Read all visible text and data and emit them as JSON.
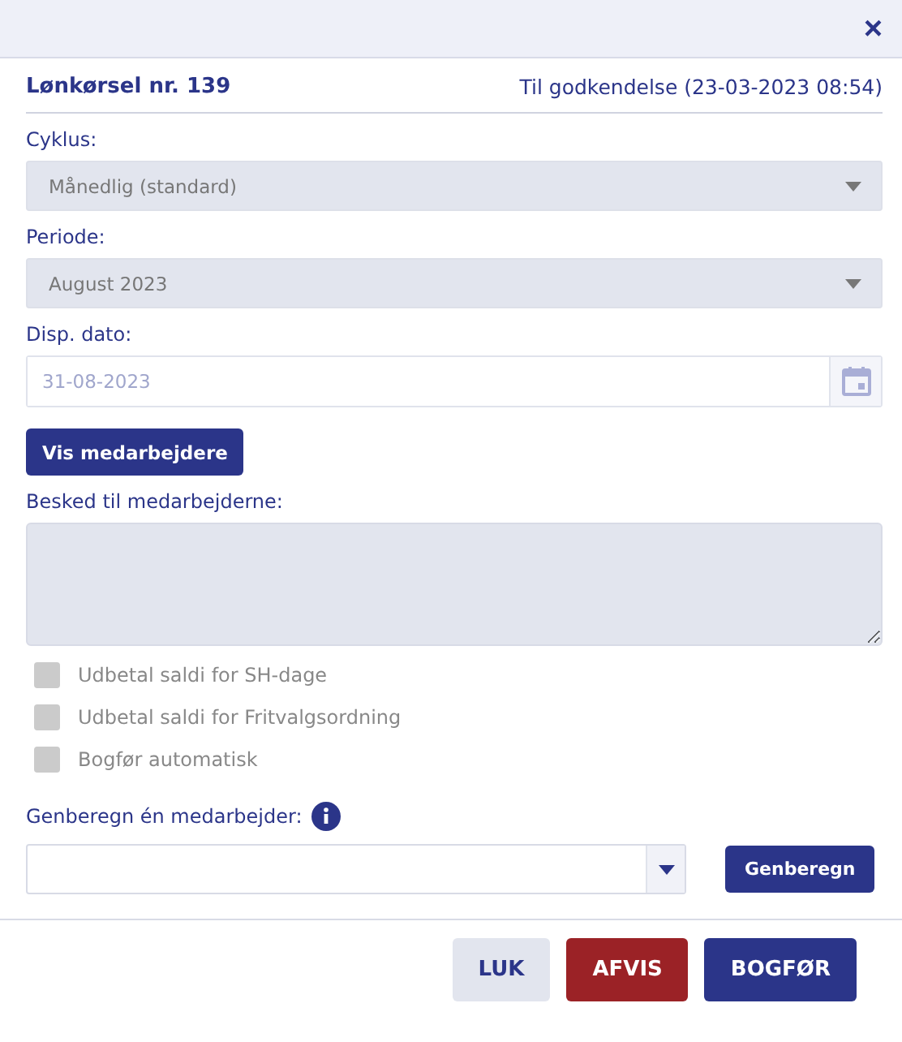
{
  "dialog": {
    "close": "×"
  },
  "header": {
    "title": "Lønkørsel nr. 139",
    "status": "Til godkendelse (23-03-2023 08:54)"
  },
  "fields": [
    {
      "kind": "select",
      "label": "Cyklus:",
      "value": "Månedlig (standard)",
      "disabled": true
    },
    {
      "kind": "select",
      "label": "Periode:",
      "value": "August 2023",
      "disabled": true
    },
    {
      "kind": "date",
      "label": "Disp. dato:",
      "placeholder": "31-08-2023"
    }
  ],
  "show_button": "Vis medarbejdere",
  "message": {
    "label": "Besked til medarbejderne:",
    "disabled": true
  },
  "checkboxes": [
    {
      "label": "Udbetal saldi for SH-dage",
      "checked": false,
      "disabled": true
    },
    {
      "label": "Udbetal saldi for Fritvalgsordning",
      "checked": false,
      "disabled": true
    },
    {
      "label": "Bogfør automatisk",
      "checked": false,
      "disabled": true
    }
  ],
  "recalc": {
    "label": "Genberegn én medarbejder:",
    "button": "Genberegn"
  },
  "footer_buttons": [
    {
      "label": "LUK",
      "kind": "neutral"
    },
    {
      "label": "AFVIS",
      "kind": "danger"
    },
    {
      "label": "BOGFØR",
      "kind": "primary"
    }
  ]
}
